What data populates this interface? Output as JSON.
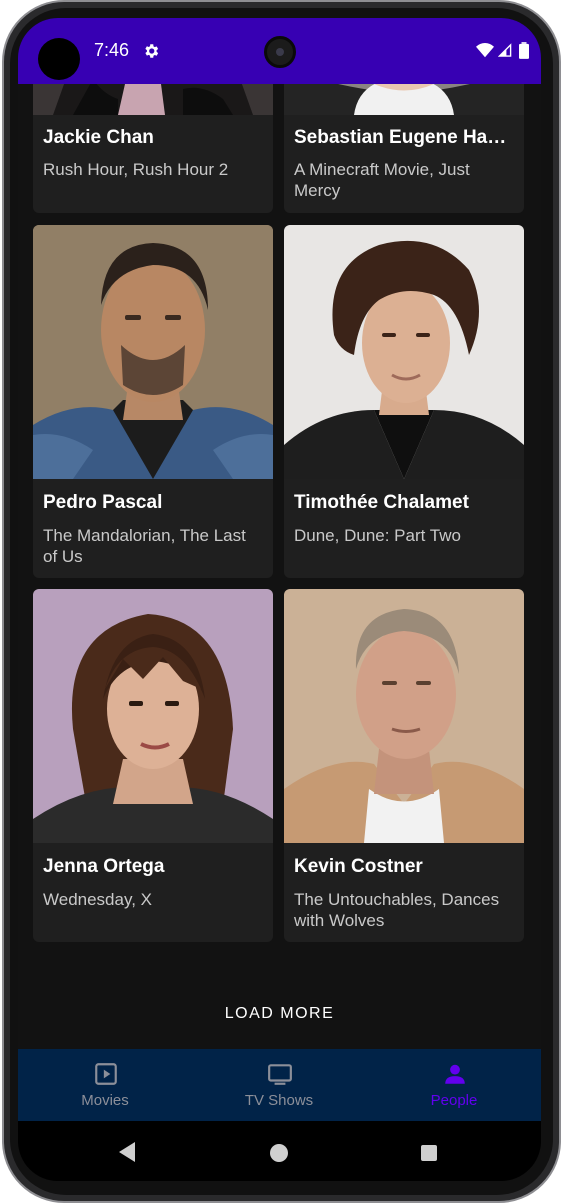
{
  "status_bar": {
    "time": "7:46",
    "icons": [
      "gear-icon",
      "wifi-icon",
      "signal-icon",
      "battery-icon"
    ],
    "color": "#3700b3"
  },
  "people": [
    {
      "name": "Jackie Chan",
      "known_for": "Rush Hour, Rush Hour 2"
    },
    {
      "name": "Sebastian Eugene Ha…",
      "known_for": "A Minecraft Movie, Just Mercy"
    },
    {
      "name": "Pedro Pascal",
      "known_for": "The Mandalorian, The Last of Us"
    },
    {
      "name": "Timothée Chalamet",
      "known_for": "Dune, Dune: Part Two"
    },
    {
      "name": "Jenna Ortega",
      "known_for": "Wednesday, X"
    },
    {
      "name": "Kevin Costner",
      "known_for": "The Untouchables, Dances with Wolves"
    }
  ],
  "load_more": {
    "label": "LOAD MORE"
  },
  "bottom_nav": {
    "items": [
      {
        "label": "Movies",
        "icon": "play-box-icon",
        "active": false
      },
      {
        "label": "TV Shows",
        "icon": "tv-icon",
        "active": false
      },
      {
        "label": "People",
        "icon": "person-icon",
        "active": true
      }
    ],
    "active_color": "#6200ee",
    "background": "#012348"
  },
  "system_nav": {
    "icons": [
      "back-icon",
      "home-icon",
      "recents-icon"
    ]
  }
}
